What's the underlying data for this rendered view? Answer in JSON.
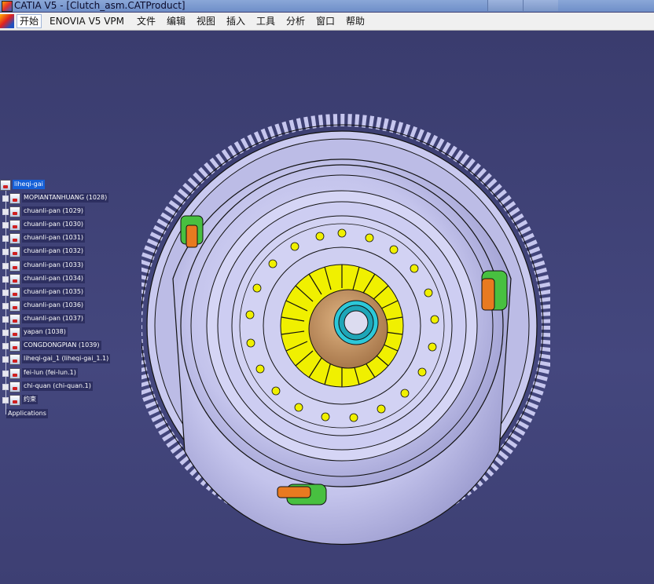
{
  "window": {
    "title": "CATIA V5 - [Clutch_asm.CATProduct]"
  },
  "menu": {
    "items": [
      "开始",
      "ENOVIA V5 VPM",
      "文件",
      "编辑",
      "视图",
      "插入",
      "工具",
      "分析",
      "窗口",
      "帮助"
    ]
  },
  "tree": {
    "root": "liheqi-gai",
    "nodes": [
      "MOPIANTANHUANG (1028)",
      "chuanli-pan (1029)",
      "chuanli-pan (1030)",
      "chuanli-pan (1031)",
      "chuanli-pan (1032)",
      "chuanli-pan (1033)",
      "chuanli-pan (1034)",
      "chuanli-pan (1035)",
      "chuanli-pan (1036)",
      "chuanli-pan (1037)",
      "yapan (1038)",
      "CONGDONGPIAN (1039)",
      "liheqi-gai_1 (liheqi-gai_1.1)",
      "fei-lun (fei-lun.1)",
      "chi-quan (chi-quan.1)",
      "约束",
      "Applications"
    ]
  },
  "colors": {
    "background": "#3d3f73",
    "part_body": "#c9c9ef",
    "spring": "#f0f000",
    "hub": "#c89a6a",
    "spline": "#2cc8d8",
    "bracket_orange": "#e87a20",
    "bracket_green": "#48c040"
  }
}
